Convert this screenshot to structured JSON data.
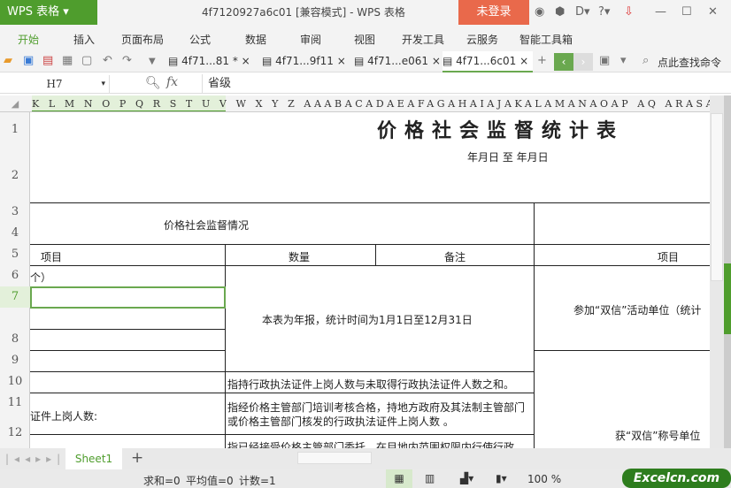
{
  "app": {
    "button": "WPS 表格",
    "title": "4f7120927a6c01 [兼容模式] - WPS 表格",
    "login": "未登录"
  },
  "menu": [
    "开始",
    "插入",
    "页面布局",
    "公式",
    "数据",
    "审阅",
    "视图",
    "开发工具",
    "云服务",
    "智能工具箱"
  ],
  "tabs": [
    "4f71...81 *",
    "4f71...9f11",
    "4f71...e061",
    "4f71...6c01"
  ],
  "search_cmd": "点此查找命令",
  "formula": {
    "cell_ref": "H7",
    "fx": "fx",
    "value": "省级"
  },
  "columns": "K L M N O P Q R S T U V W X Y Z AAABACADAEAFAGAHAIAJAKALAMANAOAP AQ ARASATAUAVAWAXAYAZBABBBC",
  "rows": [
    "1",
    "2",
    "3",
    "4",
    "5",
    "6",
    "7",
    "8",
    "9",
    "10",
    "11",
    "12"
  ],
  "cells": {
    "title": "价格社会监督统计表",
    "date": "年月日 至 年月日",
    "section": "价格社会监督情况",
    "h_item": "项目",
    "h_qty": "数量",
    "h_note": "备注",
    "h_item2": "项目",
    "r6": "个）",
    "note_merged": "本表为年报，统计时间为1月1日至12月31日",
    "right_merged": "参加“双信”活动单位（统计",
    "r11_note": "指持行政执法证件上岗人数与未取得行政执法证件人数之和。",
    "r12_label": "证件上岗人数:",
    "r12_note": "指经价格主管部门培训考核合格，持地方政府及其法制主管部门或价格主管部门核发的行政执法证件上岗人数 。",
    "r13_note": "指已经接受价格主管部门委托，在目地内范围权限内行使行政",
    "right_r12": "获“双信”称号单位"
  },
  "sheet": "Sheet1",
  "status": {
    "sum": "求和=0",
    "avg": "平均值=0",
    "count": "计数=1",
    "zoom": "100 %"
  },
  "watermark": "Excelcn.com"
}
